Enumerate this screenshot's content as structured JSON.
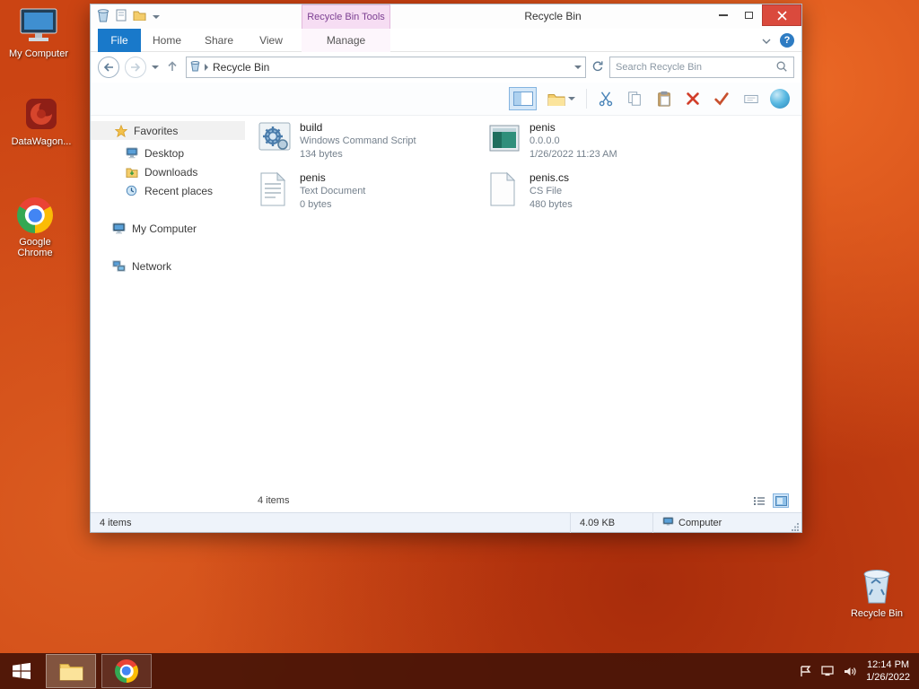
{
  "colors": {
    "desktop_base": "#cb4413",
    "file_tab": "#1979ca",
    "contextual_tab_bg": "#f6ddf3",
    "close_button": "#da4a3d",
    "taskbar": "#461307"
  },
  "desktop": {
    "icons": [
      {
        "label": "My Computer"
      },
      {
        "label": "DataWagon..."
      },
      {
        "label": "Google Chrome"
      },
      {
        "label": "Recycle Bin"
      }
    ]
  },
  "window": {
    "title": "Recycle Bin",
    "contextual_tab": "Recycle Bin Tools",
    "tabs": {
      "file": "File",
      "home": "Home",
      "share": "Share",
      "view": "View",
      "manage": "Manage"
    },
    "address": {
      "path": "Recycle Bin",
      "search_placeholder": "Search Recycle Bin"
    },
    "sidebar": {
      "favorites_label": "Favorites",
      "favorites_items": [
        {
          "label": "Desktop"
        },
        {
          "label": "Downloads"
        },
        {
          "label": "Recent places"
        }
      ],
      "my_computer": "My Computer",
      "network": "Network"
    },
    "files": [
      {
        "name": "build",
        "type": "Windows Command Script",
        "detail": "134 bytes",
        "icon": "command-script"
      },
      {
        "name": "penis",
        "type": "0.0.0.0",
        "detail": "1/26/2022 11:23 AM",
        "icon": "application"
      },
      {
        "name": "penis",
        "type": "Text Document",
        "detail": "0 bytes",
        "icon": "text-document"
      },
      {
        "name": "penis.cs",
        "type": "CS File",
        "detail": "480 bytes",
        "icon": "cs-file"
      }
    ],
    "footer_items_count": "4 items",
    "statusbar": {
      "items": "4 items",
      "size": "4.09 KB",
      "location": "Computer"
    }
  },
  "taskbar": {
    "time": "12:14 PM",
    "date": "1/26/2022"
  }
}
